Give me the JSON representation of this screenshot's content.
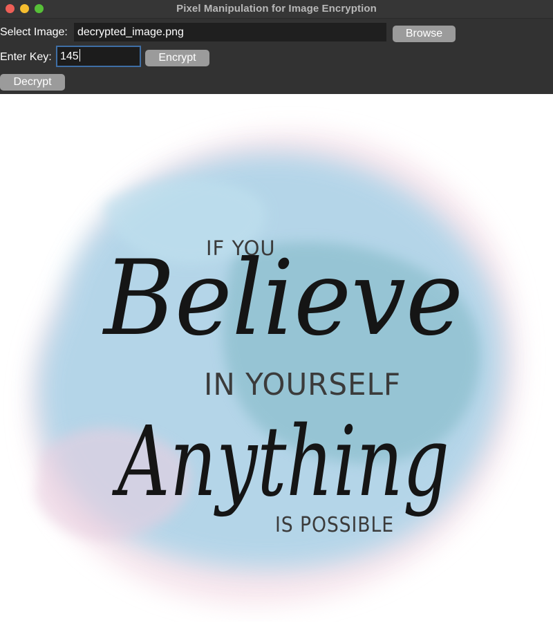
{
  "window": {
    "title": "Pixel Manipulation for Image Encryption"
  },
  "form": {
    "select_label": "Select Image:",
    "image_path": "decrypted_image.png",
    "browse_label": "Browse",
    "key_label": "Enter Key:",
    "key_value": "145",
    "encrypt_label": "Encrypt",
    "decrypt_label": "Decrypt"
  },
  "image": {
    "text_line1": "IF YOU",
    "text_line2": "Believe",
    "text_line3": "IN YOURSELF",
    "text_line4": "Anything",
    "text_line5": "IS POSSIBLE",
    "colors": {
      "watercolor_blue": "#8cc4e0",
      "watercolor_pink": "#f2d4df",
      "ink": "#151515"
    }
  }
}
